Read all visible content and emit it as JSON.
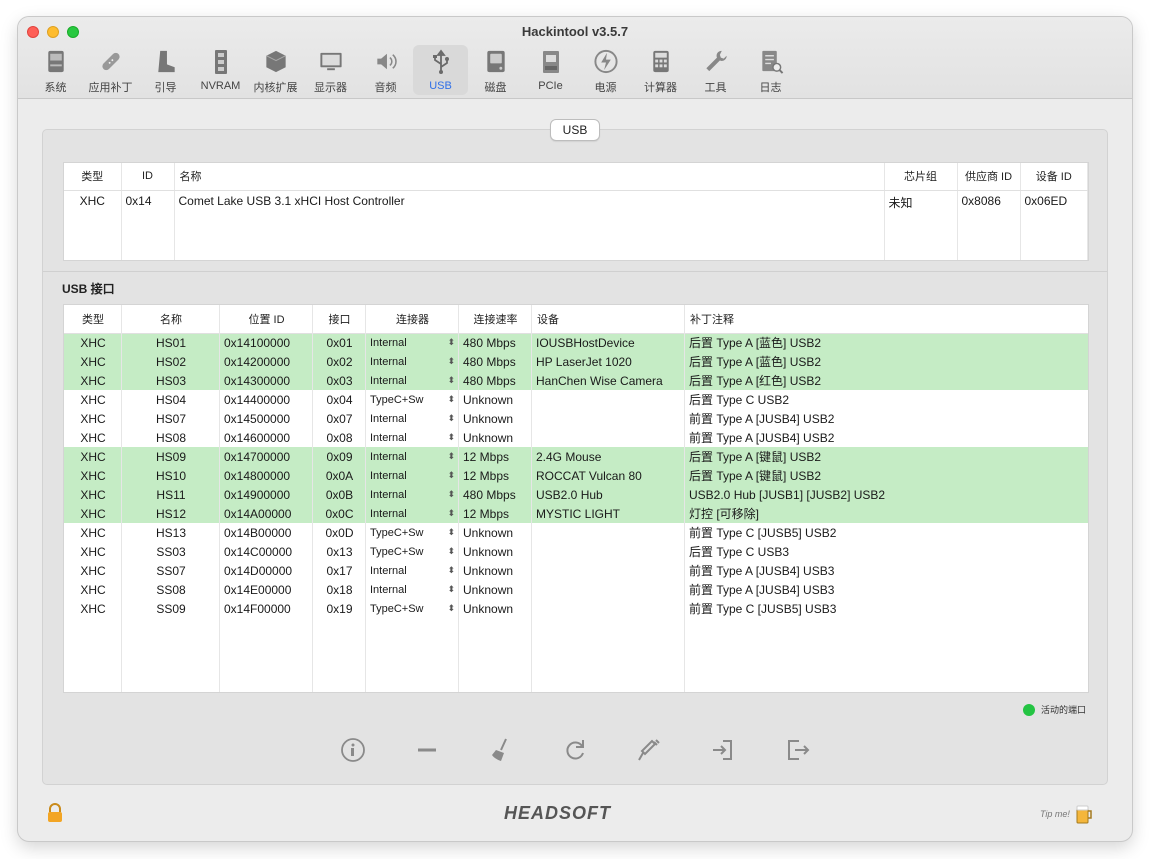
{
  "window": {
    "title": "Hackintool v3.5.7"
  },
  "toolbar": [
    {
      "label": "系统",
      "icon": "system-icon"
    },
    {
      "label": "应用补丁",
      "icon": "patch-icon"
    },
    {
      "label": "引导",
      "icon": "boot-icon"
    },
    {
      "label": "NVRAM",
      "icon": "nvram-icon"
    },
    {
      "label": "内核扩展",
      "icon": "kext-icon"
    },
    {
      "label": "显示器",
      "icon": "display-icon"
    },
    {
      "label": "音频",
      "icon": "audio-icon"
    },
    {
      "label": "USB",
      "icon": "usb-icon",
      "active": true
    },
    {
      "label": "磁盘",
      "icon": "disk-icon"
    },
    {
      "label": "PCIe",
      "icon": "pcie-icon"
    },
    {
      "label": "电源",
      "icon": "power-icon"
    },
    {
      "label": "计算器",
      "icon": "calculator-icon"
    },
    {
      "label": "工具",
      "icon": "tools-icon"
    },
    {
      "label": "日志",
      "icon": "log-icon"
    }
  ],
  "tab": {
    "label": "USB"
  },
  "controllers": {
    "headers": [
      "类型",
      "ID",
      "名称",
      "芯片组",
      "供应商 ID",
      "设备 ID"
    ],
    "rows": [
      [
        "XHC",
        "0x14",
        "Comet Lake USB 3.1 xHCI Host Controller",
        "未知",
        "0x8086",
        "0x06ED"
      ]
    ]
  },
  "ports": {
    "title": "USB 接口",
    "headers": [
      "类型",
      "名称",
      "位置 ID",
      "接口",
      "连接器",
      "连接速率",
      "设备",
      "补丁注释"
    ],
    "rows": [
      {
        "type": "XHC",
        "name": "HS01",
        "loc": "0x14100000",
        "port": "0x01",
        "conn": "Internal",
        "speed": "480 Mbps",
        "device": "IOUSBHostDevice",
        "comment": "后置 Type A [蓝色] USB2",
        "active": true
      },
      {
        "type": "XHC",
        "name": "HS02",
        "loc": "0x14200000",
        "port": "0x02",
        "conn": "Internal",
        "speed": "480 Mbps",
        "device": "HP LaserJet 1020",
        "comment": "后置 Type A [蓝色] USB2",
        "active": true
      },
      {
        "type": "XHC",
        "name": "HS03",
        "loc": "0x14300000",
        "port": "0x03",
        "conn": "Internal",
        "speed": "480 Mbps",
        "device": "HanChen Wise Camera",
        "comment": "后置 Type A [红色] USB2",
        "active": true
      },
      {
        "type": "XHC",
        "name": "HS04",
        "loc": "0x14400000",
        "port": "0x04",
        "conn": "TypeC+Sw",
        "speed": "Unknown",
        "device": "",
        "comment": "后置 Type C USB2",
        "active": false
      },
      {
        "type": "XHC",
        "name": "HS07",
        "loc": "0x14500000",
        "port": "0x07",
        "conn": "Internal",
        "speed": "Unknown",
        "device": "",
        "comment": "前置 Type A [JUSB4] USB2",
        "active": false
      },
      {
        "type": "XHC",
        "name": "HS08",
        "loc": "0x14600000",
        "port": "0x08",
        "conn": "Internal",
        "speed": "Unknown",
        "device": "",
        "comment": "前置 Type A [JUSB4] USB2",
        "active": false
      },
      {
        "type": "XHC",
        "name": "HS09",
        "loc": "0x14700000",
        "port": "0x09",
        "conn": "Internal",
        "speed": "12 Mbps",
        "device": "2.4G Mouse",
        "comment": "后置 Type A [键鼠] USB2",
        "active": true
      },
      {
        "type": "XHC",
        "name": "HS10",
        "loc": "0x14800000",
        "port": "0x0A",
        "conn": "Internal",
        "speed": "12 Mbps",
        "device": "ROCCAT Vulcan 80",
        "comment": "后置 Type A [键鼠] USB2",
        "active": true
      },
      {
        "type": "XHC",
        "name": "HS11",
        "loc": "0x14900000",
        "port": "0x0B",
        "conn": "Internal",
        "speed": "480 Mbps",
        "device": "USB2.0 Hub",
        "comment": "USB2.0 Hub [JUSB1] [JUSB2] USB2",
        "active": true
      },
      {
        "type": "XHC",
        "name": "HS12",
        "loc": "0x14A00000",
        "port": "0x0C",
        "conn": "Internal",
        "speed": "12 Mbps",
        "device": "MYSTIC LIGHT",
        "comment": "灯控 [可移除]",
        "active": true
      },
      {
        "type": "XHC",
        "name": "HS13",
        "loc": "0x14B00000",
        "port": "0x0D",
        "conn": "TypeC+Sw",
        "speed": "Unknown",
        "device": "",
        "comment": "前置 Type C [JUSB5] USB2",
        "active": false
      },
      {
        "type": "XHC",
        "name": "SS03",
        "loc": "0x14C00000",
        "port": "0x13",
        "conn": "TypeC+Sw",
        "speed": "Unknown",
        "device": "",
        "comment": "后置 Type C USB3",
        "active": false
      },
      {
        "type": "XHC",
        "name": "SS07",
        "loc": "0x14D00000",
        "port": "0x17",
        "conn": "Internal",
        "speed": "Unknown",
        "device": "",
        "comment": "前置 Type A [JUSB4] USB3",
        "active": false
      },
      {
        "type": "XHC",
        "name": "SS08",
        "loc": "0x14E00000",
        "port": "0x18",
        "conn": "Internal",
        "speed": "Unknown",
        "device": "",
        "comment": "前置 Type A [JUSB4] USB3",
        "active": false
      },
      {
        "type": "XHC",
        "name": "SS09",
        "loc": "0x14F00000",
        "port": "0x19",
        "conn": "TypeC+Sw",
        "speed": "Unknown",
        "device": "",
        "comment": "前置 Type C [JUSB5] USB3",
        "active": false
      }
    ]
  },
  "legend": {
    "label": "活动的端口",
    "color": "#24c443"
  },
  "actions": [
    "info-icon",
    "minus-icon",
    "broom-icon",
    "refresh-icon",
    "syringe-icon",
    "import-icon",
    "export-icon"
  ],
  "footer": {
    "logo": "HEADSOFT",
    "tip": "Tip me!"
  },
  "colors": {
    "accent": "#2f6fe8",
    "active_row": "#c5ecc5"
  }
}
